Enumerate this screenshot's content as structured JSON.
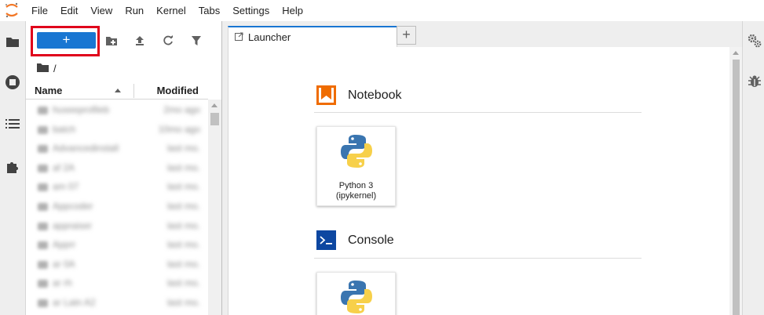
{
  "menubar": {
    "items": [
      "File",
      "Edit",
      "View",
      "Run",
      "Kernel",
      "Tabs",
      "Settings",
      "Help"
    ]
  },
  "left_bar": {
    "icons": [
      "folder-icon",
      "running-sessions-icon",
      "table-of-contents-icon",
      "extensions-icon"
    ]
  },
  "file_browser": {
    "new_launcher_label": "+",
    "breadcrumb": "/",
    "columns": {
      "name": "Name",
      "modified": "Modified"
    },
    "rows": [
      {
        "name": "huseeprofileb",
        "modified": "2mo ago"
      },
      {
        "name": "batch",
        "modified": "10mo ago"
      },
      {
        "name": "Advancedinstall",
        "modified": "last mo."
      },
      {
        "name": "af 2A",
        "modified": "last mo."
      },
      {
        "name": "am 07",
        "modified": "last mo."
      },
      {
        "name": "Appcoder",
        "modified": "last mo."
      },
      {
        "name": "appraiser",
        "modified": "last mo."
      },
      {
        "name": "Apprr",
        "modified": "last mo."
      },
      {
        "name": "ar 0A",
        "modified": "last mo."
      },
      {
        "name": "ar rh",
        "modified": "last mo."
      },
      {
        "name": "ar Latn A2",
        "modified": "last mo."
      }
    ]
  },
  "tabs": [
    {
      "label": "Launcher",
      "active": true
    }
  ],
  "tab_add_label": "+",
  "launcher": {
    "sections": [
      {
        "title": "Notebook",
        "card_label_line1": "Python 3",
        "card_label_line2": "(ipykernel)"
      },
      {
        "title": "Console"
      }
    ]
  },
  "colors": {
    "accent_blue": "#1976d2",
    "highlight_red": "#e0001b",
    "notebook_orange": "#ef6c00",
    "console_blue": "#0d47a1"
  }
}
